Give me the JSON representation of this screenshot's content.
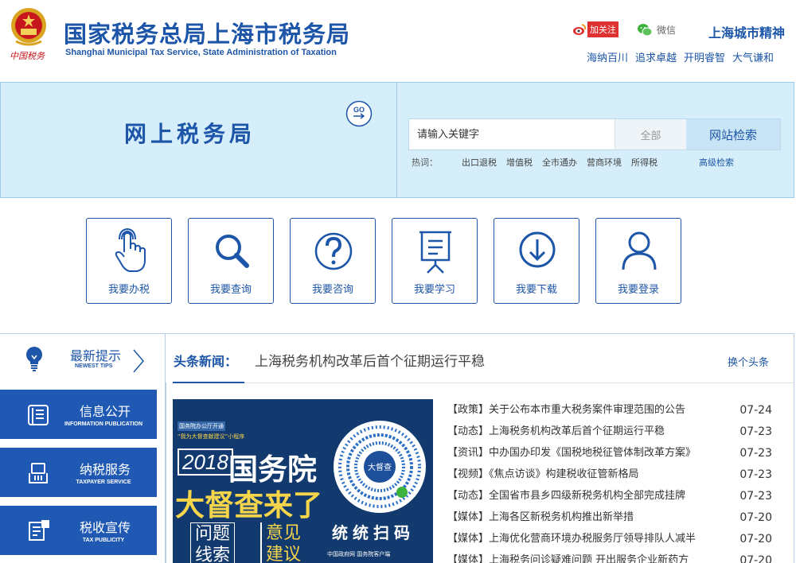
{
  "header": {
    "emblem_caption": "中国税务",
    "title": "国家税务总局上海市税务局",
    "subtitle": "Shanghai Municipal Tax Service, State Administration of Taxation",
    "weibo_label": "加关注",
    "wechat_label": "微信",
    "spirit_title": "上海城市精神",
    "spirit_words": [
      "海纳百川",
      "追求卓越",
      "开明睿智",
      "大气谦和"
    ]
  },
  "banner": {
    "title": "网上税务局",
    "go_icon": "go-arrow-icon",
    "search": {
      "placeholder": "请输入关键字",
      "scope": "全部",
      "button": "网站检索"
    },
    "hot_label": "热词：",
    "hot_words": [
      "出口退税",
      "增值税",
      "全市通办",
      "营商环境",
      "所得税"
    ],
    "advanced": "高级检索"
  },
  "quick_links": [
    {
      "label": "我要办税",
      "icon": "hand-touch-icon"
    },
    {
      "label": "我要查询",
      "icon": "search-icon"
    },
    {
      "label": "我要咨询",
      "icon": "question-icon"
    },
    {
      "label": "我要学习",
      "icon": "presentation-board-icon"
    },
    {
      "label": "我要下载",
      "icon": "download-icon"
    },
    {
      "label": "我要登录",
      "icon": "user-icon"
    }
  ],
  "tips": {
    "title": "最新提示",
    "subtitle": "NEWEST TIPS"
  },
  "side_menu": [
    {
      "cn": "信息公开",
      "en": "INFORMATION PUBLICATION",
      "icon": "document-icon"
    },
    {
      "cn": "纳税服务",
      "en": "TAXPAYER SERVICE",
      "icon": "tax-hand-icon"
    },
    {
      "cn": "税收宣传",
      "en": "TAX PUBLICITY",
      "icon": "notice-icon"
    }
  ],
  "headline": {
    "label": "头条新闻：",
    "text": "上海税务机构改革后首个征期运行平稳",
    "switch": "换个头条"
  },
  "poster": {
    "tag1": "国务院办公厅开通",
    "tag2": "“我为大督查献建议”小程序",
    "year": "2018",
    "line1": "国务院",
    "line2": "大督查来了",
    "q1": "问题线索",
    "q2": "意见建议",
    "qr_label": "大督查",
    "scan": "统统扫码",
    "footer": "中国政府网  国务院客户端"
  },
  "news": [
    {
      "title": "【政策】关于公布本市重大税务案件审理范围的公告",
      "date": "07-24"
    },
    {
      "title": "【动态】上海税务机构改革后首个征期运行平稳",
      "date": "07-23"
    },
    {
      "title": "【资讯】中办国办印发《国税地税征管体制改革方案》",
      "date": "07-23"
    },
    {
      "title": "【视频】《焦点访谈》构建税收征管新格局",
      "date": "07-23"
    },
    {
      "title": "【动态】全国省市县乡四级新税务机构全部完成挂牌",
      "date": "07-23"
    },
    {
      "title": "【媒体】上海各区新税务机构推出新举措",
      "date": "07-20"
    },
    {
      "title": "【媒体】上海优化营商环境办税服务厅领导排队人减半",
      "date": "07-20"
    },
    {
      "title": "【媒体】上海税务问诊疑难问题 开出服务企业新药方",
      "date": "07-20"
    }
  ]
}
